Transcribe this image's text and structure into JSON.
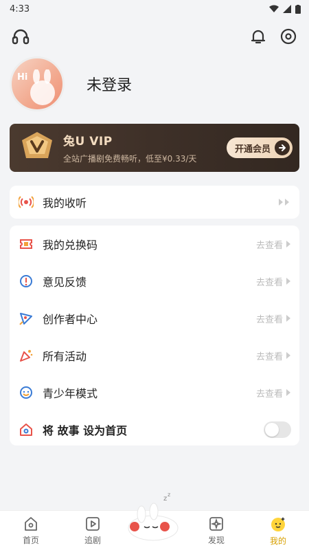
{
  "status_bar": {
    "time": "4:33"
  },
  "profile": {
    "avatar_text": "Hi",
    "login_label": "未登录"
  },
  "vip": {
    "title": "兔U VIP",
    "subtitle": "全站广播剧免费畅听，低至¥0.33/天",
    "button": "开通会员"
  },
  "listen": {
    "label": "我的收听"
  },
  "list": {
    "more_label": "去查看",
    "items": [
      {
        "label": "我的兑换码",
        "icon": "ticket-icon"
      },
      {
        "label": "意见反馈",
        "icon": "feedback-icon"
      },
      {
        "label": "创作者中心",
        "icon": "creator-icon"
      },
      {
        "label": "所有活动",
        "icon": "party-icon"
      },
      {
        "label": "青少年模式",
        "icon": "teen-mode-icon"
      }
    ],
    "homepage_label": "将 故事 设为首页",
    "homepage_toggle": false
  },
  "nav": {
    "items": [
      {
        "label": "首页",
        "active": false
      },
      {
        "label": "追剧",
        "active": false
      },
      {
        "label": "发现",
        "active": false
      },
      {
        "label": "我的",
        "active": true
      }
    ]
  },
  "colors": {
    "accent": "#d7a000",
    "vip_bg": "#3e3028",
    "vip_gold": "#f3dcc0",
    "icon_red": "#e8534a"
  }
}
